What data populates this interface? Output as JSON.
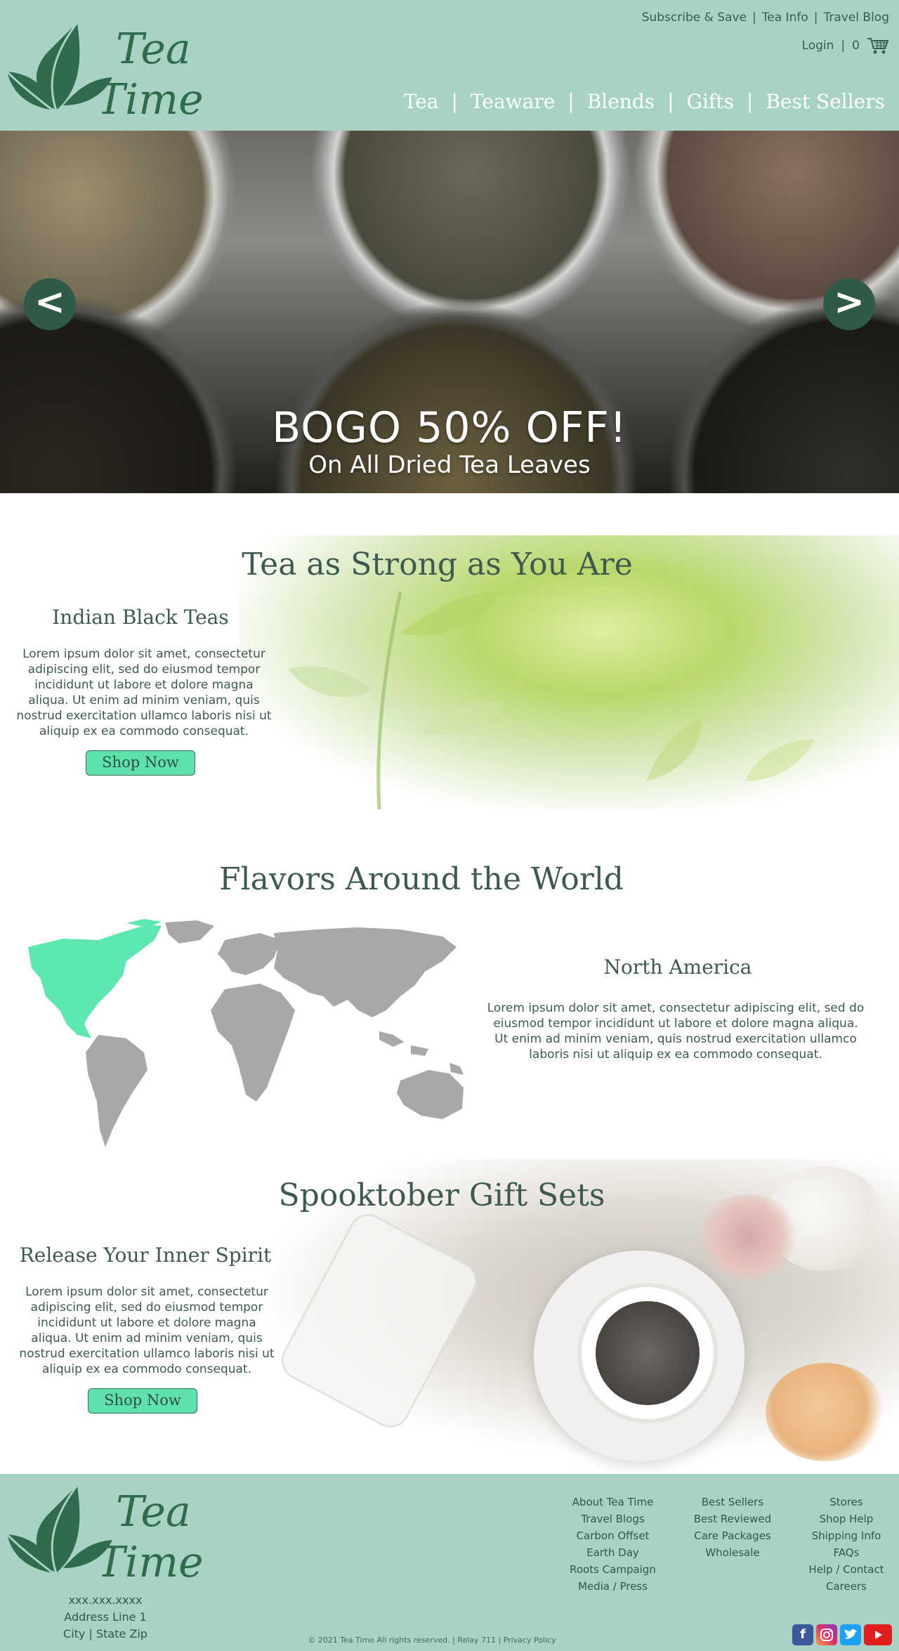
{
  "header": {
    "logo_line1": "Tea",
    "logo_line2": "Time",
    "util_links": [
      "Subscribe & Save",
      "Tea Info",
      "Travel Blog"
    ],
    "login_label": "Login",
    "cart_count": "0",
    "nav": [
      "Tea",
      "Teaware",
      "Blends",
      "Gifts",
      "Best Sellers"
    ]
  },
  "hero": {
    "prev_label": "<",
    "next_label": ">",
    "title": "BOGO 50% OFF!",
    "subtitle": "On All Dried Tea Leaves"
  },
  "section_strong": {
    "title": "Tea as Strong as You Are",
    "subhead": "Indian Black Teas",
    "body": "Lorem ipsum dolor sit amet, consectetur adipiscing elit, sed do eiusmod tempor incididunt ut labore et dolore magna aliqua. Ut enim ad minim veniam, quis nostrud exercitation ullamco laboris nisi ut aliquip ex ea commodo consequat.",
    "button": "Shop Now"
  },
  "section_flavors": {
    "title": "Flavors Around the World",
    "subhead": "North America",
    "body": "Lorem ipsum dolor sit amet, consectetur adipiscing elit, sed do eiusmod tempor incididunt ut labore et dolore magna aliqua. Ut enim ad minim veniam, quis nostrud exercitation ullamco laboris nisi ut aliquip ex ea commodo consequat."
  },
  "section_gifts": {
    "title": "Spooktober Gift Sets",
    "subhead": "Release Your Inner Spirit",
    "body": "Lorem ipsum dolor sit amet, consectetur adipiscing elit, sed do eiusmod tempor incididunt ut labore et dolore magna aliqua. Ut enim ad minim veniam, quis nostrud exercitation ullamco laboris nisi ut aliquip ex ea commodo consequat.",
    "button": "Shop Now"
  },
  "footer": {
    "phone": "xxx.xxx.xxxx",
    "address": "Address Line 1",
    "city": "City | State Zip",
    "col1": [
      "About Tea Time",
      "Travel Blogs",
      "Carbon Offset",
      "Earth Day",
      "Roots Campaign",
      "Media / Press"
    ],
    "col2": [
      "Best Sellers",
      "Best Reviewed",
      "Care Packages",
      "Wholesale"
    ],
    "col3": [
      "Stores",
      "Shop Help",
      "Shipping Info",
      "FAQs",
      "Help / Contact",
      "Careers"
    ],
    "copyright": "© 2021 Tea Time All rights reserved.  |  Relay 711  |  Privacy Policy",
    "socials": [
      "facebook-icon",
      "instagram-icon",
      "twitter-icon",
      "youtube-icon"
    ]
  },
  "colors": {
    "header_bg": "#a8d3c4",
    "accent_green": "#5fe1ae",
    "dark_green": "#2f5a47",
    "text": "#3e5a50"
  }
}
